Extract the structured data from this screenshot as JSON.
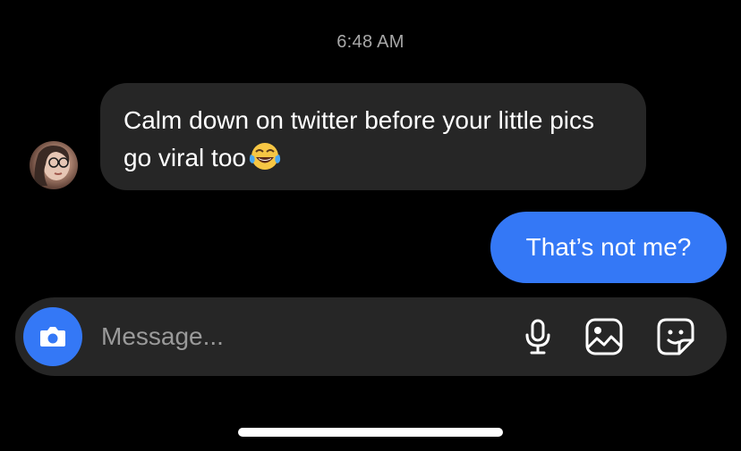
{
  "thread": {
    "timestamp": "6:48 AM"
  },
  "messages": [
    {
      "direction": "incoming",
      "text": "Calm down on twitter before your little pics go viral too",
      "emoji": "face-with-tears-of-joy"
    },
    {
      "direction": "outgoing",
      "text": "That’s not me?"
    }
  ],
  "composer": {
    "placeholder": "Message...",
    "camera_icon": "camera-icon",
    "mic_icon": "microphone-icon",
    "photo_icon": "image-icon",
    "sticker_icon": "sticker-icon"
  },
  "colors": {
    "background": "#000000",
    "incoming_bubble": "#262626",
    "outgoing_bubble": "#3478f6",
    "timestamp_text": "#a8a8a8",
    "placeholder_text": "#9a9a9a"
  }
}
